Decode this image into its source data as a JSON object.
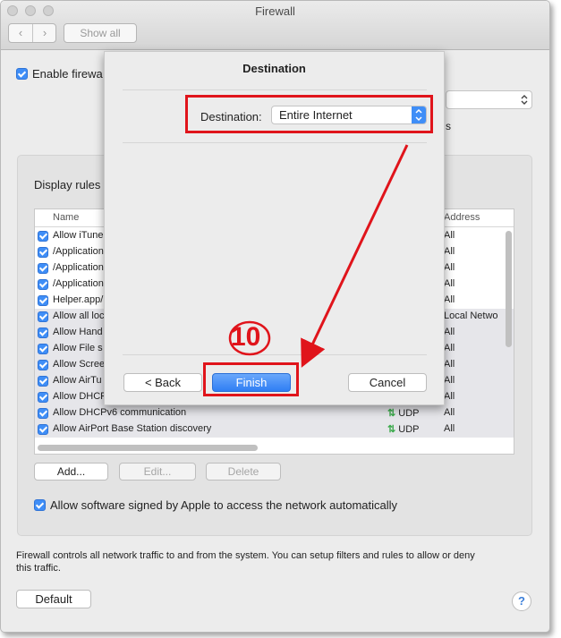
{
  "window": {
    "title": "Firewall"
  },
  "toolbar": {
    "back_icon": "‹",
    "forward_icon": "›",
    "show_all_label": "Show all"
  },
  "main": {
    "enable_firewall_label": "Enable firewa",
    "trailing_s": "s",
    "display_rules_label": "Display rules",
    "table": {
      "col_name": "Name",
      "col_address": "Address",
      "rows": [
        {
          "name": "Allow iTune",
          "proto": "",
          "address": "All"
        },
        {
          "name": "/Application",
          "proto": "",
          "address": "All"
        },
        {
          "name": "/Application",
          "proto": "",
          "address": "All"
        },
        {
          "name": "/Application",
          "proto": "",
          "address": "All"
        },
        {
          "name": "Helper.app/",
          "proto": "",
          "address": "All"
        },
        {
          "name": "Allow all loc",
          "proto": "",
          "address": "Local Netwo"
        },
        {
          "name": "Allow Hand",
          "proto": "",
          "address": "All"
        },
        {
          "name": "Allow File s",
          "proto": "",
          "address": "All"
        },
        {
          "name": "Allow Scree",
          "proto": "",
          "address": "All"
        },
        {
          "name": "Allow AirTu",
          "proto": "",
          "address": "All"
        },
        {
          "name": "Allow DHCP",
          "proto": "",
          "address": "All"
        },
        {
          "name": "Allow DHCPv6 communication",
          "proto": "UDP",
          "address": "All"
        },
        {
          "name": "Allow AirPort Base Station discovery",
          "proto": "UDP",
          "address": "All"
        }
      ]
    },
    "add_label": "Add...",
    "edit_label": "Edit...",
    "delete_label": "Delete",
    "allow_signed_label": "Allow software signed by Apple to access the network automatically",
    "footer_text_line1": "Firewall controls all network traffic to and from the system. You can setup filters and rules to allow or deny",
    "footer_text_line2": "this traffic.",
    "default_label": "Default",
    "help_label": "?"
  },
  "sheet": {
    "title": "Destination",
    "destination_label": "Destination:",
    "destination_value": "Entire Internet",
    "back_label": "< Back",
    "finish_label": "Finish",
    "cancel_label": "Cancel"
  },
  "annotation": {
    "step": "10"
  },
  "colors": {
    "accent": "#3f8ef7",
    "annotation_red": "#e0141b"
  }
}
